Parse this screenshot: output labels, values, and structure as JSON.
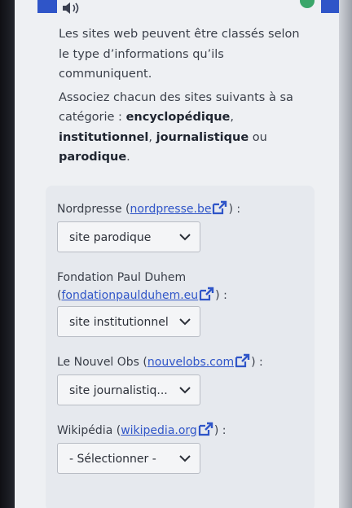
{
  "intro": {
    "p1": "Les sites web peuvent être classés selon le type d’informations qu’ils communiquent.",
    "p2_prefix": "Associez chacun des sites suivants à sa catégorie : ",
    "cat1": "encyclopédique",
    "sep1": ", ",
    "cat2": "institutionnel",
    "sep2": ", ",
    "cat3": "journalistique",
    "sep3": " ou ",
    "cat4": "parodique",
    "end": "."
  },
  "questions": [
    {
      "name": "Nordpresse",
      "open": " (",
      "url": "nordpresse.be",
      "close": ") :",
      "selected": "site parodique"
    },
    {
      "name": "Fondation Paul Duhem",
      "open": "(",
      "url": "fondationpaulduhem.eu",
      "close": ") :",
      "selected": "site institutionnel"
    },
    {
      "name": "Le Nouvel Obs",
      "open": " (",
      "url": "nouvelobs.com",
      "close": ") :",
      "selected": "site journalistiq..."
    },
    {
      "name": "Wikipédia",
      "open": " (",
      "url": "wikipedia.org",
      "close": ") :",
      "selected": "- Sélectionner -"
    }
  ],
  "icons": {
    "audio": "speaker-icon",
    "external": "external-link-icon",
    "chevron": "chevron-down-icon"
  },
  "colors": {
    "link": "#2f55c8",
    "accent_blue": "#2f55c8",
    "green": "#3aa66a"
  }
}
